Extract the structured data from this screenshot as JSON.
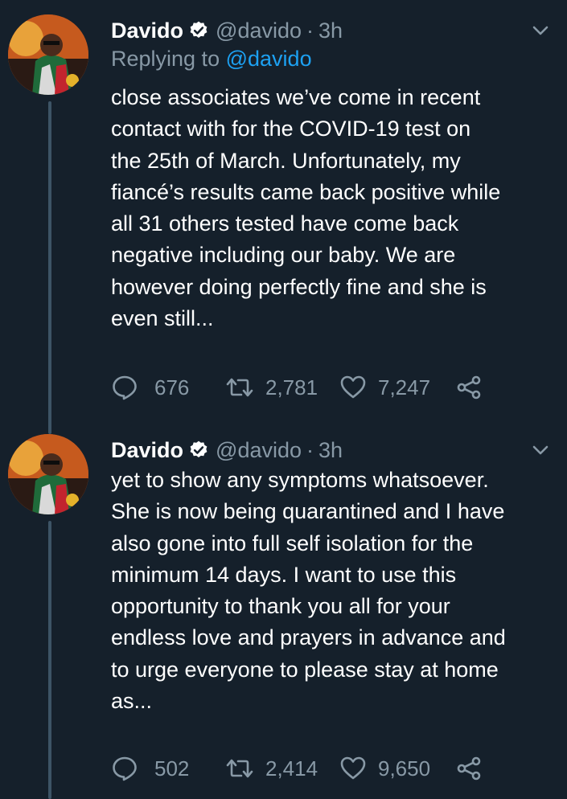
{
  "colors": {
    "background": "#15202b",
    "secondary_text": "#8899a6",
    "link": "#1da1f2",
    "thread_line": "#3d5466"
  },
  "tweets": [
    {
      "author_name": "Davido",
      "verified_icon": "verified-badge-icon",
      "handle": "@davido",
      "separator": "·",
      "time": "3h",
      "replying_prefix": "Replying to",
      "replying_to": "@davido",
      "text": "close associates we’ve come in recent\ncontact with for the COVID-19 test on\nthe 25th of March. Unfortunately, my\nfiancé’s results came back positive while\nall 31 others tested have come back\nnegative including our baby. We are\nhowever doing perfectly fine and she is\neven still...",
      "replies": "676",
      "retweets": "2,781",
      "likes": "7,247"
    },
    {
      "author_name": "Davido",
      "verified_icon": "verified-badge-icon",
      "handle": "@davido",
      "separator": "·",
      "time": "3h",
      "text": "yet to show any symptoms whatsoever.\nShe is now being quarantined and I have\nalso gone into full self isolation for the\nminimum 14 days. I want to use this\nopportunity to thank you all for your\nendless love and prayers in advance and\nto urge everyone to please stay at home\nas...",
      "replies": "502",
      "retweets": "2,414",
      "likes": "9,650"
    }
  ]
}
